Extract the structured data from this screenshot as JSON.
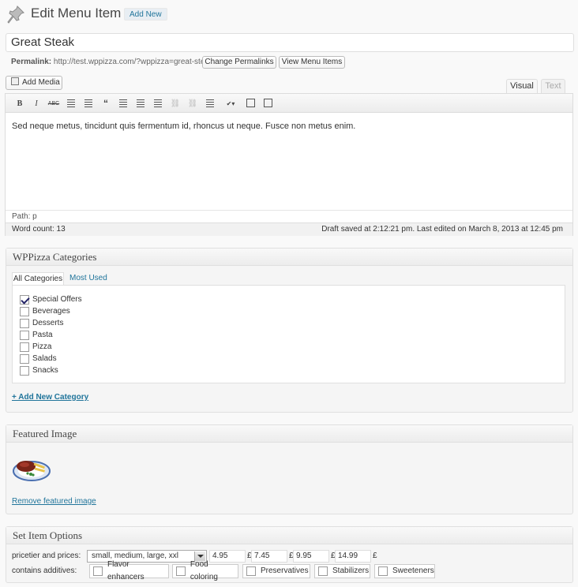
{
  "header": {
    "title": "Edit Menu Item",
    "add_new": "Add New"
  },
  "post": {
    "title": "Great Steak",
    "permalink_label": "Permalink:",
    "permalink_url": "http://test.wppizza.com/?wppizza=great-steak",
    "change_permalinks": "Change Permalinks",
    "view_items": "View Menu Items"
  },
  "editor": {
    "add_media": "Add Media",
    "tab_visual": "Visual",
    "tab_text": "Text",
    "content": "Sed neque metus, tincidunt quis fermentum id, rhoncus ut neque. Fusce non metus enim.",
    "path": "Path: p",
    "word_count": "Word count: 13",
    "draft_status": "Draft saved at 2:12:21 pm. Last edited on March 8, 2013 at 12:45 pm",
    "toolbar_icons": [
      "bold-icon",
      "italic-icon",
      "strikethrough-icon",
      "bullet-list-icon",
      "numbered-list-icon",
      "blockquote-icon",
      "align-left-icon",
      "align-center-icon",
      "align-right-icon",
      "link-icon",
      "unlink-icon",
      "more-tag-icon",
      "spellcheck-icon",
      "fullscreen-icon",
      "kitchen-sink-icon"
    ]
  },
  "categories_box": {
    "title": "WPPizza Categories",
    "tab_all": "All Categories",
    "tab_used": "Most Used",
    "items": [
      {
        "label": "Special Offers",
        "checked": true
      },
      {
        "label": "Beverages",
        "checked": false
      },
      {
        "label": "Desserts",
        "checked": false
      },
      {
        "label": "Pasta",
        "checked": false
      },
      {
        "label": "Pizza",
        "checked": false
      },
      {
        "label": "Salads",
        "checked": false
      },
      {
        "label": "Snacks",
        "checked": false
      }
    ],
    "add_new": "+ Add New Category"
  },
  "featured_box": {
    "title": "Featured Image",
    "remove": "Remove featured image"
  },
  "options_box": {
    "title": "Set Item Options",
    "pricetier_label": "pricetier and prices:",
    "pricetier_value": "small, medium, large, xxl",
    "prices": [
      "4.95",
      "7.45",
      "9.95",
      "14.99"
    ],
    "currency": "£",
    "additives_label": "contains additives:",
    "additives": [
      "Flavor enhancers",
      "Food coloring",
      "Preservatives",
      "Stabilizers",
      "Sweeteners"
    ]
  }
}
